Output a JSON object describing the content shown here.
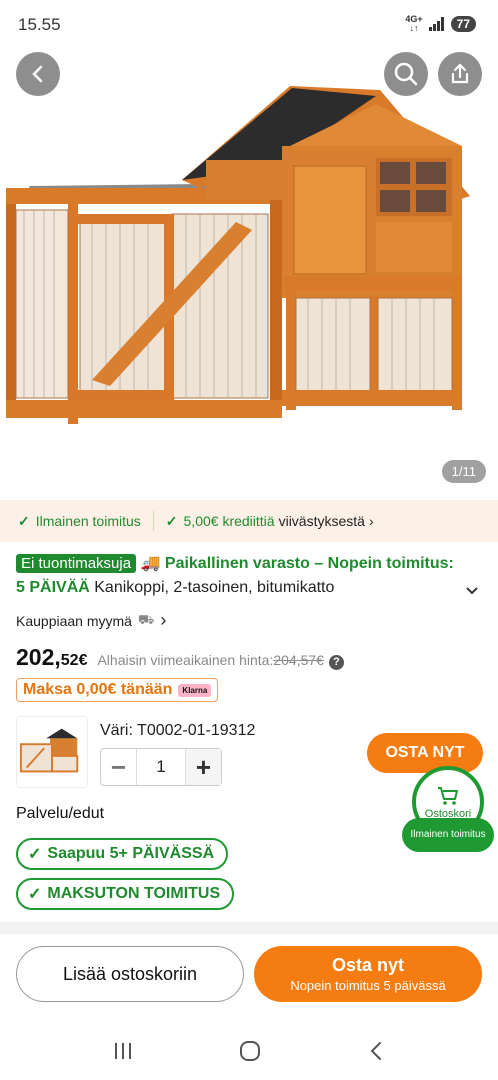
{
  "status": {
    "time": "15.55",
    "network_top": "4G+",
    "network_bottom": "↓↑",
    "battery": "77"
  },
  "gallery": {
    "counter": "1/11"
  },
  "benefits": {
    "item1": "Ilmainen toimitus",
    "item2_green": "5,00€ krediittiä",
    "item2_dark": "viivästyksestä"
  },
  "product": {
    "badge": "Ei tuontimaksuja",
    "shipping_text": "Paikallinen varasto – Nopein toimitus: 5 PÄIVÄÄ",
    "title": "Kanikoppi, 2-tasoinen, bitumikatto",
    "seller": "Kauppiaan myymä",
    "price_main": "202,",
    "price_cents": "52€",
    "price_note": "Alhaisin viimeaikainen hinta:",
    "price_old": "204,57€",
    "pay_today": "Maksa 0,00€ tänään",
    "klarna": "Klarna",
    "variant": "Väri: T0002-01-19312",
    "quantity": "1"
  },
  "actions": {
    "buy_now_small": "OSTA NYT",
    "cart_label": "Ostoskori",
    "cart_ribbon": "Ilmainen toimitus"
  },
  "services": {
    "title": "Palvelu/edut",
    "pill1": "Saapuu 5+ PÄIVÄSSÄ",
    "pill2": "MAKSUTON TOIMITUS"
  },
  "bottom": {
    "add_to_cart": "Lisää ostoskoriin",
    "buy_now": "Osta nyt",
    "buy_now_sub": "Nopein toimitus 5 päivässä"
  },
  "colors": {
    "accent_orange": "#f57c10",
    "green": "#1f8a2e",
    "benefit_bg": "#fdf1e7"
  }
}
